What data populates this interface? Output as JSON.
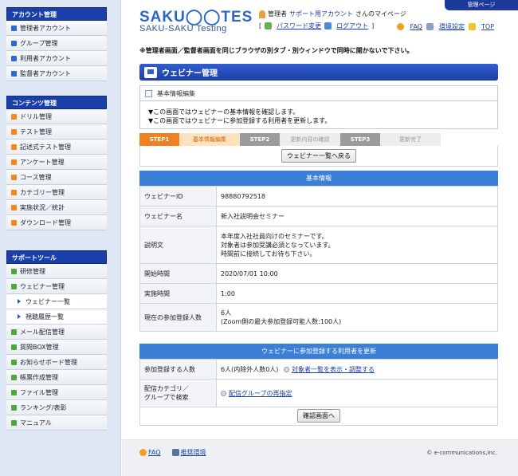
{
  "sidebar": {
    "sections": [
      {
        "title": "アカウント管理",
        "items": [
          {
            "label": "管理者アカウント",
            "color": "#2a6bd1"
          },
          {
            "label": "グループ管理",
            "color": "#2a6bd1"
          },
          {
            "label": "利用者アカウント",
            "color": "#2a6bd1"
          },
          {
            "label": "監督者アカウント",
            "color": "#2a6bd1"
          }
        ]
      },
      {
        "title": "コンテンツ管理",
        "items": [
          {
            "label": "ドリル管理",
            "color": "#f08a1c"
          },
          {
            "label": "テスト管理",
            "color": "#f08a1c"
          },
          {
            "label": "記述式テスト管理",
            "color": "#f08a1c"
          },
          {
            "label": "アンケート管理",
            "color": "#f08a1c"
          },
          {
            "label": "コース管理",
            "color": "#f08a1c"
          },
          {
            "label": "カテゴリー管理",
            "color": "#f08a1c"
          },
          {
            "label": "実施状況／統計",
            "color": "#f08a1c"
          },
          {
            "label": "ダウンロード管理",
            "color": "#f08a1c"
          }
        ]
      },
      {
        "title": "サポートツール",
        "items": [
          {
            "label": "研修管理",
            "color": "#4caa3c",
            "sub": false
          },
          {
            "label": "ウェビナー管理",
            "color": "#4caa3c",
            "sub": false
          },
          {
            "label": "ウェビナー一覧",
            "sub": true
          },
          {
            "label": "視聴履歴一覧",
            "sub": true
          },
          {
            "label": "メール配信管理",
            "color": "#4caa3c",
            "sub": false
          },
          {
            "label": "質問BOX管理",
            "color": "#4caa3c",
            "sub": false
          },
          {
            "label": "お知らせボード管理",
            "color": "#4caa3c",
            "sub": false
          },
          {
            "label": "帳票作成管理",
            "color": "#4caa3c",
            "sub": false
          },
          {
            "label": "ファイル管理",
            "color": "#4caa3c",
            "sub": false
          },
          {
            "label": "ランキング/表彰",
            "color": "#4caa3c",
            "sub": false
          },
          {
            "label": "マニュアル",
            "color": "#4caa3c",
            "sub": false
          }
        ]
      }
    ]
  },
  "header": {
    "tab": "管理ページ",
    "logo_top": "SAKU◯◯TES",
    "logo_bottom": "SAKU-SAKU Testing",
    "user_prefix": "管理者",
    "user_account": "サポート用アカウント",
    "user_suffix": "さんのマイページ",
    "bracket_open": "[",
    "bracket_close": "]",
    "password_link": "パスワード変更",
    "logout_link": "ログアウト",
    "faq": "FAQ",
    "settings": "環境設定",
    "top": "TOP"
  },
  "warning": "※管理者画面／監督者画面を同じブラウザの別タブ・別ウィンドウで同時に開かないで下さい。",
  "page_title": "ウェビナー管理",
  "panel": {
    "title": "基本情報編集",
    "line1": "▼この画面ではウェビナーの基本情報を確認します。",
    "line2": "▼この画面ではウェビナーに参加登録する利用者を更新します。"
  },
  "steps": [
    {
      "label": "STEP1",
      "type": "num",
      "active": true
    },
    {
      "label": "基本情報編集",
      "type": "lbl",
      "active": true
    },
    {
      "label": "STEP2",
      "type": "num",
      "active": false
    },
    {
      "label": "更新内容の確認",
      "type": "lbl",
      "active": false
    },
    {
      "label": "STEP3",
      "type": "num",
      "active": false
    },
    {
      "label": "更新完了",
      "type": "lbl",
      "active": false
    }
  ],
  "back_button": "ウェビナー一覧へ戻る",
  "basic_info": {
    "header": "基本情報",
    "rows": [
      {
        "key": "ウェビナーID",
        "value": "98880792518"
      },
      {
        "key": "ウェビナー名",
        "value": "新入社説明会セミナー"
      },
      {
        "key": "説明文",
        "value_lines": [
          "本年度入社社員向けのセミナーです。",
          "対象者は参加受講必須となっています。",
          "時間前に接続してお待ち下さい。"
        ]
      },
      {
        "key": "開始時間",
        "value": "2020/07/01 10:00"
      },
      {
        "key": "実施時間",
        "value": "1:00"
      },
      {
        "key": "現在の参加登録人数",
        "value_lines": [
          "6人",
          "(Zoom側の最大参加登録可能人数:100人)"
        ]
      }
    ]
  },
  "update": {
    "header": "ウェビナーに参加登録する利用者を更新",
    "count_key": "参加登録する人数",
    "count_value": "6人(内除外人数0人)",
    "count_link": "対象者一覧を表示・調整する",
    "search_key_1": "配信カテゴリ／",
    "search_key_2": "グループで検索",
    "search_link": "配信グループの再指定"
  },
  "confirm_button": "確認画面へ",
  "footer": {
    "faq": "FAQ",
    "env": "推奨環境",
    "copyright": "© e-communications,Inc."
  }
}
